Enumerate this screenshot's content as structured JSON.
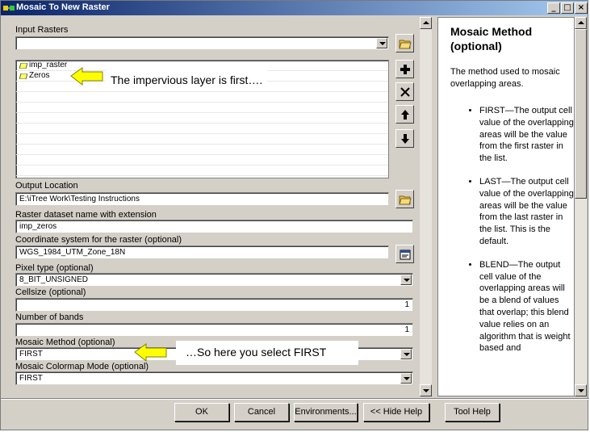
{
  "window": {
    "title": "Mosaic To New Raster",
    "minimize": "_",
    "maximize": "□",
    "close": "×"
  },
  "form": {
    "input_rasters_label": "Input Rasters",
    "input_rasters_value": "",
    "input_list": [
      {
        "name": "imp_raster"
      },
      {
        "name": "Zeros"
      }
    ],
    "output_location_label": "Output Location",
    "output_location_value": "E:\\iTree Work\\Testing Instructions",
    "dataset_name_label": "Raster dataset name with extension",
    "dataset_name_value": "imp_zeros",
    "coord_label": "Coordinate system for the raster (optional)",
    "coord_value": "WGS_1984_UTM_Zone_18N",
    "pixel_type_label": "Pixel type (optional)",
    "pixel_type_value": "8_BIT_UNSIGNED",
    "cellsize_label": "Cellsize (optional)",
    "cellsize_value": "1",
    "bands_label": "Number of bands",
    "bands_value": "1",
    "mosaic_method_label": "Mosaic Method (optional)",
    "mosaic_method_value": "FIRST",
    "colormap_label": "Mosaic Colormap Mode (optional)",
    "colormap_value": "FIRST"
  },
  "callouts": {
    "first": "The impervious layer is first….",
    "second": "…So here you select FIRST"
  },
  "help": {
    "title": "Mosaic Method (optional)",
    "intro": "The method used to mosaic overlapping areas.",
    "items": [
      "FIRST—The output cell value of the overlapping areas will be the value from the first raster in the list.",
      "LAST—The output cell value of the overlapping areas will be the value from the last raster in the list. This is the default.",
      "BLEND—The output cell value of the overlapping areas will be a blend of values that overlap; this blend value relies on an algorithm that is weight based and"
    ]
  },
  "buttons": {
    "ok": "OK",
    "cancel": "Cancel",
    "environments": "Environments...",
    "hide_help": "<< Hide Help",
    "tool_help": "Tool Help"
  },
  "colors": {
    "callout_arrow": "#ffff00",
    "title_start": "#0a246a",
    "title_end": "#a6caf0"
  }
}
